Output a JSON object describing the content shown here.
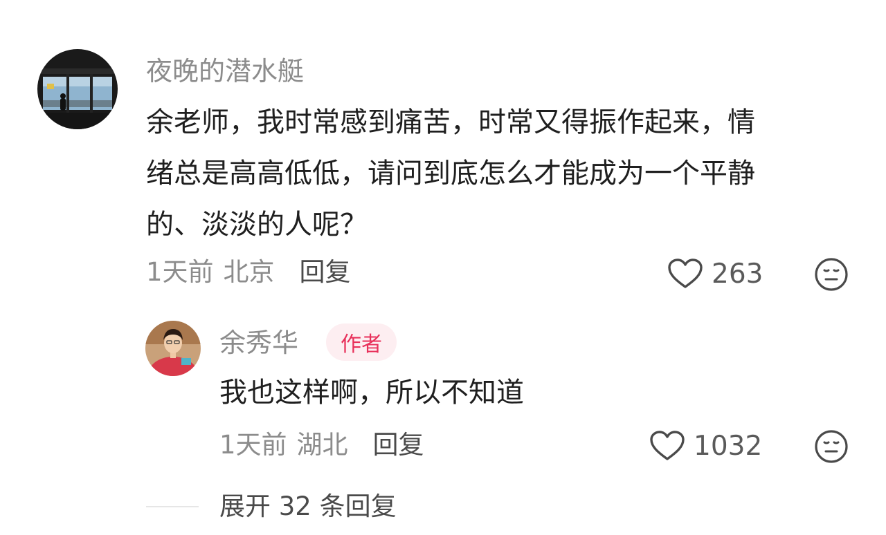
{
  "comment": {
    "username": "夜晚的潜水艇",
    "content_lines": [
      "余老师，我时常感到痛苦，时常又得振作起来，情",
      "绪总是高高低低，请问到底怎么才能成为一个平静",
      "的、淡淡的人呢？"
    ],
    "time": "1天前",
    "location": "北京",
    "reply_label": "回复",
    "like_count": "263",
    "like_icon": "heart-outline-icon",
    "dislike_icon": "neutral-face-icon"
  },
  "reply": {
    "username": "余秀华",
    "badge": "作者",
    "content": "我也这样啊，所以不知道",
    "time": "1天前",
    "location": "湖北",
    "reply_label": "回复",
    "like_count": "1032",
    "like_icon": "heart-outline-icon",
    "dislike_icon": "neutral-face-icon"
  },
  "expand": {
    "label": "展开 32 条回复"
  },
  "colors": {
    "username": "#8c8c8c",
    "text": "#1f1f1f",
    "badge_bg": "#fdeef1",
    "badge_text": "#e8305a",
    "icon": "#4a4a4a"
  }
}
